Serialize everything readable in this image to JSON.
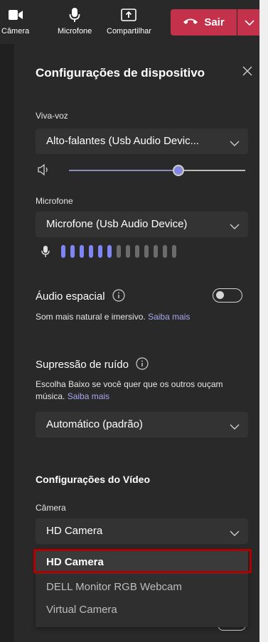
{
  "toolbar": {
    "camera_label": "Câmera",
    "microphone_label": "Microfone",
    "share_label": "Compartilhar",
    "leave_label": "Sair"
  },
  "panel": {
    "title": "Configurações de dispositivo"
  },
  "speaker": {
    "label": "Viva-voz",
    "selected": "Alto-falantes (Usb Audio Devic...",
    "volume_fraction": 0.62
  },
  "microphone": {
    "label": "Microfone",
    "selected": "Microfone (Usb Audio Device)",
    "level_bars_on": 6,
    "level_bars_total": 13
  },
  "spatial_audio": {
    "title": "Áudio espacial",
    "description": "Som mais natural e imersivo.",
    "link": "Saiba mais",
    "enabled": false
  },
  "noise_suppression": {
    "title": "Supressão de ruído",
    "description": "Escolha Baixo se você quer que os outros ouçam música.",
    "link": "Saiba mais",
    "selected": "Automático (padrão)"
  },
  "video": {
    "section_title": "Configurações do Vídeo",
    "camera_label": "Câmera",
    "selected": "HD Camera",
    "options": [
      "HD Camera",
      "DELL Monitor RGB Webcam",
      "Virtual Camera"
    ]
  },
  "colors": {
    "leave_red": "#c4314b",
    "accent": "#7f85f5",
    "highlight_box": "#b00000",
    "panel_bg": "#292929"
  }
}
